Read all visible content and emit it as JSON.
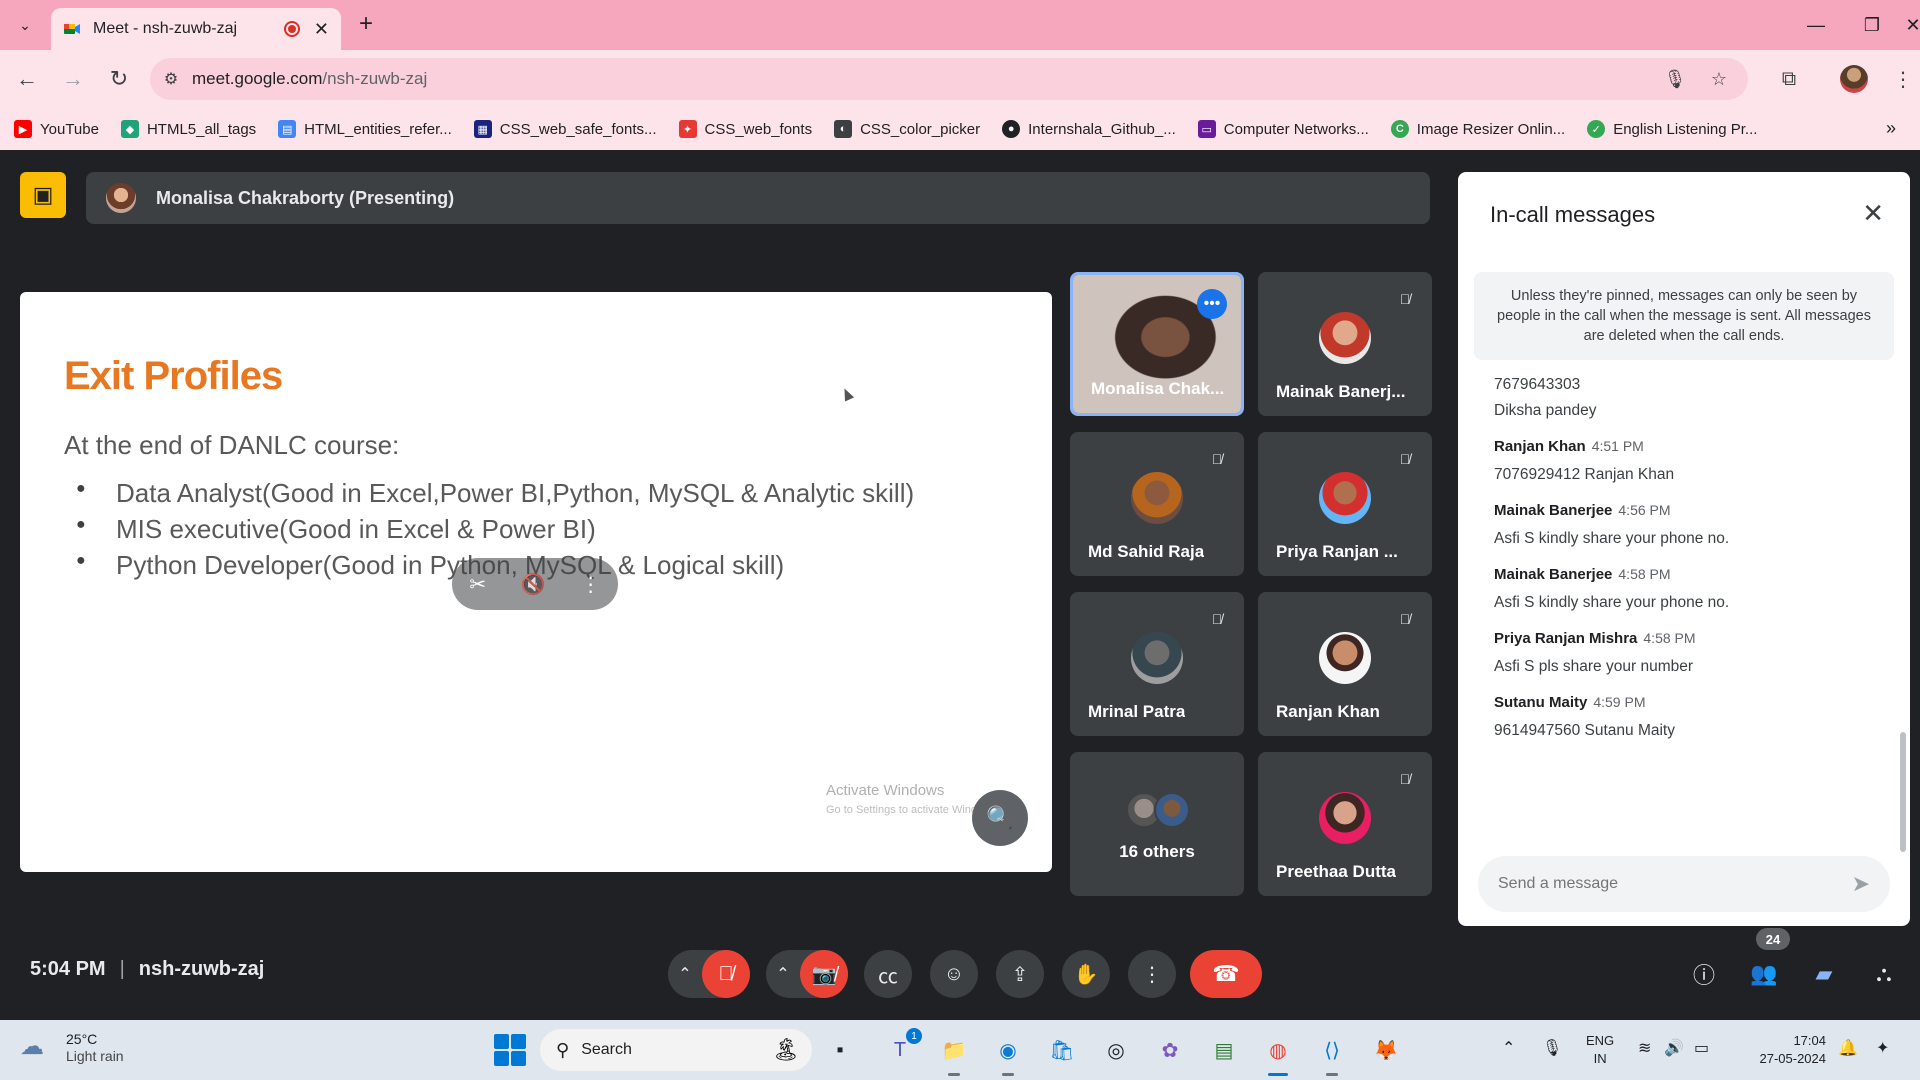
{
  "browser": {
    "tab_title": "Meet - nsh-zuwb-zaj",
    "url_host": "meet.google.com",
    "url_path": "/nsh-zuwb-zaj",
    "bookmarks": [
      {
        "label": "YouTube",
        "icon": "youtube-icon",
        "color": "#ff0000"
      },
      {
        "label": "HTML5_all_tags",
        "icon": "html5-icon",
        "color": "#1fa37a"
      },
      {
        "label": "HTML_entities_refer...",
        "icon": "doc-icon",
        "color": "#4285f4"
      },
      {
        "label": "CSS_web_safe_fonts...",
        "icon": "site-icon",
        "color": "#1a237e"
      },
      {
        "label": "CSS_web_fonts",
        "icon": "fonts-icon",
        "color": "#e53935"
      },
      {
        "label": "CSS_color_picker",
        "icon": "color-picker-icon",
        "color": "#3c4043"
      },
      {
        "label": "Internshala_Github_...",
        "icon": "github-icon",
        "color": "#202124"
      },
      {
        "label": "Computer Networks...",
        "icon": "video-icon",
        "color": "#6a1b9a"
      },
      {
        "label": "Image Resizer Onlin...",
        "icon": "resize-icon",
        "color": "#34a853"
      },
      {
        "label": "English Listening Pr...",
        "icon": "check-icon",
        "color": "#34a853"
      }
    ]
  },
  "meet": {
    "presenter_text": "Monalisa Chakraborty (Presenting)",
    "slide": {
      "heading": "Exit Profiles",
      "subheading": "At the end of DANLC course:",
      "bullets": [
        "Data Analyst(Good in Excel,Power BI,Python, MySQL & Analytic skill)",
        "MIS executive(Good in Excel & Power BI)",
        "Python Developer(Good in Python, MySQL & Logical skill)"
      ],
      "watermark_title": "Activate Windows",
      "watermark_sub": "Go to Settings to activate Windows."
    },
    "tiles": [
      {
        "name": "Monalisa Chak..."
      },
      {
        "name": "Mainak Banerj..."
      },
      {
        "name": "Md Sahid Raja"
      },
      {
        "name": "Priya Ranjan ..."
      },
      {
        "name": "Mrinal Patra"
      },
      {
        "name": "Ranjan Khan"
      },
      {
        "name": "16 others"
      },
      {
        "name": "Preethaa Dutta"
      }
    ],
    "chat": {
      "title": "In-call messages",
      "notice": "Unless they're pinned, messages can only be seen by people in the call when the message is sent. All messages are deleted when the call ends.",
      "partial_lines": [
        "7679643303",
        "Diksha pandey"
      ],
      "messages": [
        {
          "sender": "Ranjan Khan",
          "time": "4:51 PM",
          "text": "7076929412 Ranjan Khan"
        },
        {
          "sender": "Mainak Banerjee",
          "time": "4:56 PM",
          "text": "Asfi S kindly share your phone no."
        },
        {
          "sender": "Mainak Banerjee",
          "time": "4:58 PM",
          "text": "Asfi S kindly share your phone no."
        },
        {
          "sender": "Priya Ranjan Mishra",
          "time": "4:58 PM",
          "text": "Asfi S pls share your number"
        },
        {
          "sender": "Sutanu Maity",
          "time": "4:59 PM",
          "text": "9614947560 Sutanu Maity"
        }
      ],
      "input_placeholder": "Send a message"
    },
    "time": "5:04 PM",
    "meeting_code": "nsh-zuwb-zaj",
    "people_count": "24"
  },
  "taskbar": {
    "temp": "25°C",
    "weather": "Light rain",
    "search_placeholder": "Search",
    "teams_badge": "1",
    "lang_line1": "ENG",
    "lang_line2": "IN",
    "clock_time": "17:04",
    "clock_date": "27-05-2024"
  }
}
